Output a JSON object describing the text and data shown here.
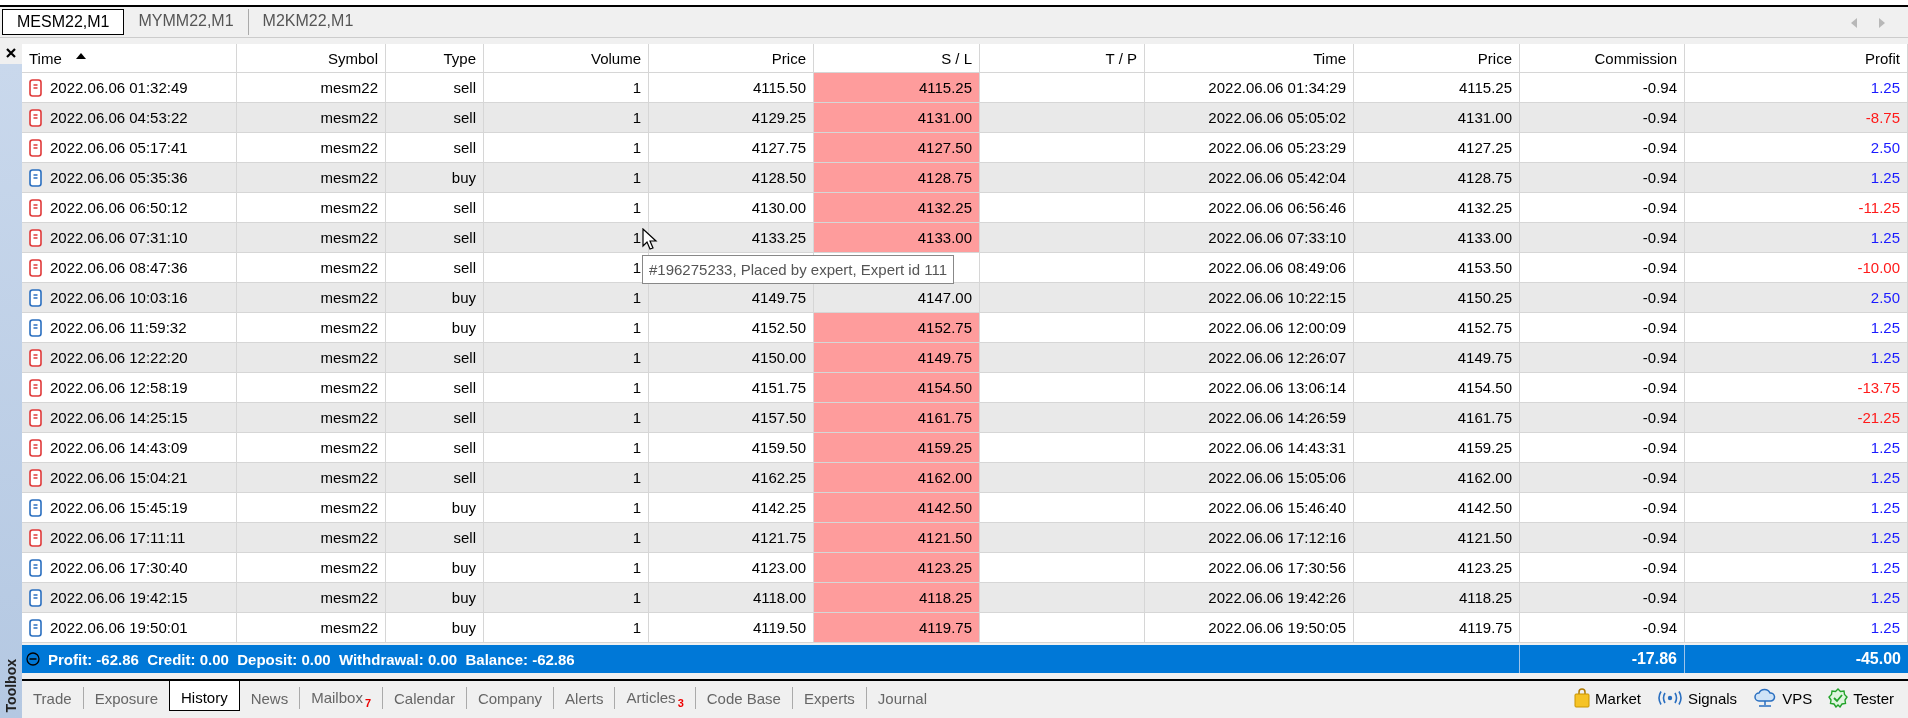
{
  "chart_tabs": [
    {
      "label": "MESM22,M1",
      "selected": true
    },
    {
      "label": "MYMM22,M1",
      "selected": false
    },
    {
      "label": "M2KM22,M1",
      "selected": false
    }
  ],
  "columns": [
    {
      "label": "Time",
      "sorted": true
    },
    {
      "label": "Symbol",
      "sorted": false
    },
    {
      "label": "Type",
      "sorted": false
    },
    {
      "label": "Volume",
      "sorted": false
    },
    {
      "label": "Price",
      "sorted": false
    },
    {
      "label": "S / L",
      "sorted": false
    },
    {
      "label": "T / P",
      "sorted": false
    },
    {
      "label": "Time",
      "sorted": false
    },
    {
      "label": "Price",
      "sorted": false
    },
    {
      "label": "Commission",
      "sorted": false
    },
    {
      "label": "Profit",
      "sorted": false
    }
  ],
  "rows": [
    {
      "kind": "sell",
      "time": "2022.06.06 01:32:49",
      "symbol": "mesm22",
      "type": "sell",
      "volume": "1",
      "price": "4115.50",
      "sl": "4115.25",
      "sl_hit": true,
      "close_time": "2022.06.06 01:34:29",
      "close_price": "4115.25",
      "commission": "-0.94",
      "profit": "1.25",
      "loss": false
    },
    {
      "kind": "sell",
      "time": "2022.06.06 04:53:22",
      "symbol": "mesm22",
      "type": "sell",
      "volume": "1",
      "price": "4129.25",
      "sl": "4131.00",
      "sl_hit": true,
      "close_time": "2022.06.06 05:05:02",
      "close_price": "4131.00",
      "commission": "-0.94",
      "profit": "-8.75",
      "loss": true
    },
    {
      "kind": "sell",
      "time": "2022.06.06 05:17:41",
      "symbol": "mesm22",
      "type": "sell",
      "volume": "1",
      "price": "4127.75",
      "sl": "4127.50",
      "sl_hit": true,
      "close_time": "2022.06.06 05:23:29",
      "close_price": "4127.25",
      "commission": "-0.94",
      "profit": "2.50",
      "loss": false
    },
    {
      "kind": "buy",
      "time": "2022.06.06 05:35:36",
      "symbol": "mesm22",
      "type": "buy",
      "volume": "1",
      "price": "4128.50",
      "sl": "4128.75",
      "sl_hit": true,
      "close_time": "2022.06.06 05:42:04",
      "close_price": "4128.75",
      "commission": "-0.94",
      "profit": "1.25",
      "loss": false
    },
    {
      "kind": "sell",
      "time": "2022.06.06 06:50:12",
      "symbol": "mesm22",
      "type": "sell",
      "volume": "1",
      "price": "4130.00",
      "sl": "4132.25",
      "sl_hit": true,
      "close_time": "2022.06.06 06:56:46",
      "close_price": "4132.25",
      "commission": "-0.94",
      "profit": "-11.25",
      "loss": true
    },
    {
      "kind": "sell",
      "time": "2022.06.06 07:31:10",
      "symbol": "mesm22",
      "type": "sell",
      "volume": "1",
      "price": "4133.25",
      "sl": "4133.00",
      "sl_hit": true,
      "close_time": "2022.06.06 07:33:10",
      "close_price": "4133.00",
      "commission": "-0.94",
      "profit": "1.25",
      "loss": false
    },
    {
      "kind": "sell",
      "time": "2022.06.06 08:47:36",
      "symbol": "mesm22",
      "type": "sell",
      "volume": "1",
      "sl_hit": false,
      "close_time": "2022.06.06 08:49:06",
      "close_price": "4153.50",
      "commission": "-0.94",
      "profit": "-10.00",
      "loss": true
    },
    {
      "kind": "buy",
      "time": "2022.06.06 10:03:16",
      "symbol": "mesm22",
      "type": "buy",
      "volume": "1",
      "price": "4149.75",
      "sl": "4147.00",
      "sl_hit": false,
      "close_time": "2022.06.06 10:22:15",
      "close_price": "4150.25",
      "commission": "-0.94",
      "profit": "2.50",
      "loss": false
    },
    {
      "kind": "buy",
      "time": "2022.06.06 11:59:32",
      "symbol": "mesm22",
      "type": "buy",
      "volume": "1",
      "price": "4152.50",
      "sl": "4152.75",
      "sl_hit": true,
      "close_time": "2022.06.06 12:00:09",
      "close_price": "4152.75",
      "commission": "-0.94",
      "profit": "1.25",
      "loss": false
    },
    {
      "kind": "sell",
      "time": "2022.06.06 12:22:20",
      "symbol": "mesm22",
      "type": "sell",
      "volume": "1",
      "price": "4150.00",
      "sl": "4149.75",
      "sl_hit": true,
      "close_time": "2022.06.06 12:26:07",
      "close_price": "4149.75",
      "commission": "-0.94",
      "profit": "1.25",
      "loss": false
    },
    {
      "kind": "sell",
      "time": "2022.06.06 12:58:19",
      "symbol": "mesm22",
      "type": "sell",
      "volume": "1",
      "price": "4151.75",
      "sl": "4154.50",
      "sl_hit": true,
      "close_time": "2022.06.06 13:06:14",
      "close_price": "4154.50",
      "commission": "-0.94",
      "profit": "-13.75",
      "loss": true
    },
    {
      "kind": "sell",
      "time": "2022.06.06 14:25:15",
      "symbol": "mesm22",
      "type": "sell",
      "volume": "1",
      "price": "4157.50",
      "sl": "4161.75",
      "sl_hit": true,
      "close_time": "2022.06.06 14:26:59",
      "close_price": "4161.75",
      "commission": "-0.94",
      "profit": "-21.25",
      "loss": true
    },
    {
      "kind": "sell",
      "time": "2022.06.06 14:43:09",
      "symbol": "mesm22",
      "type": "sell",
      "volume": "1",
      "price": "4159.50",
      "sl": "4159.25",
      "sl_hit": true,
      "close_time": "2022.06.06 14:43:31",
      "close_price": "4159.25",
      "commission": "-0.94",
      "profit": "1.25",
      "loss": false
    },
    {
      "kind": "sell",
      "time": "2022.06.06 15:04:21",
      "symbol": "mesm22",
      "type": "sell",
      "volume": "1",
      "price": "4162.25",
      "sl": "4162.00",
      "sl_hit": true,
      "close_time": "2022.06.06 15:05:06",
      "close_price": "4162.00",
      "commission": "-0.94",
      "profit": "1.25",
      "loss": false
    },
    {
      "kind": "buy",
      "time": "2022.06.06 15:45:19",
      "symbol": "mesm22",
      "type": "buy",
      "volume": "1",
      "price": "4142.25",
      "sl": "4142.50",
      "sl_hit": true,
      "close_time": "2022.06.06 15:46:40",
      "close_price": "4142.50",
      "commission": "-0.94",
      "profit": "1.25",
      "loss": false
    },
    {
      "kind": "sell",
      "time": "2022.06.06 17:11:11",
      "symbol": "mesm22",
      "type": "sell",
      "volume": "1",
      "price": "4121.75",
      "sl": "4121.50",
      "sl_hit": true,
      "close_time": "2022.06.06 17:12:16",
      "close_price": "4121.50",
      "commission": "-0.94",
      "profit": "1.25",
      "loss": false
    },
    {
      "kind": "buy",
      "time": "2022.06.06 17:30:40",
      "symbol": "mesm22",
      "type": "buy",
      "volume": "1",
      "price": "4123.00",
      "sl": "4123.25",
      "sl_hit": true,
      "close_time": "2022.06.06 17:30:56",
      "close_price": "4123.25",
      "commission": "-0.94",
      "profit": "1.25",
      "loss": false
    },
    {
      "kind": "buy",
      "time": "2022.06.06 19:42:15",
      "symbol": "mesm22",
      "type": "buy",
      "volume": "1",
      "price": "4118.00",
      "sl": "4118.25",
      "sl_hit": true,
      "close_time": "2022.06.06 19:42:26",
      "close_price": "4118.25",
      "commission": "-0.94",
      "profit": "1.25",
      "loss": false
    },
    {
      "kind": "buy",
      "time": "2022.06.06 19:50:01",
      "symbol": "mesm22",
      "type": "buy",
      "volume": "1",
      "price": "4119.50",
      "sl": "4119.75",
      "sl_hit": true,
      "close_time": "2022.06.06 19:50:05",
      "close_price": "4119.75",
      "commission": "-0.94",
      "profit": "1.25",
      "loss": false
    }
  ],
  "tooltip": "#196275233, Placed by expert, Expert id 111",
  "summary": {
    "text": "Profit: -62.86  Credit: 0.00  Deposit: 0.00  Withdrawal: 0.00  Balance: -62.86",
    "commission": "-17.86",
    "profit": "-45.00"
  },
  "toolbox_label": "Toolbox",
  "bottom_tabs": [
    {
      "label": "Trade",
      "selected": false
    },
    {
      "label": "Exposure",
      "selected": false
    },
    {
      "label": "History",
      "selected": true
    },
    {
      "label": "News",
      "selected": false
    },
    {
      "label": "Mailbox",
      "selected": false,
      "badge": "7"
    },
    {
      "label": "Calendar",
      "selected": false
    },
    {
      "label": "Company",
      "selected": false
    },
    {
      "label": "Alerts",
      "selected": false
    },
    {
      "label": "Articles",
      "selected": false,
      "badge": "3"
    },
    {
      "label": "Code Base",
      "selected": false
    },
    {
      "label": "Experts",
      "selected": false
    },
    {
      "label": "Journal",
      "selected": false
    }
  ],
  "tools": [
    {
      "kind": "market",
      "label": "Market"
    },
    {
      "kind": "signals",
      "label": "Signals"
    },
    {
      "kind": "vps",
      "label": "VPS"
    },
    {
      "kind": "tester",
      "label": "Tester"
    }
  ]
}
